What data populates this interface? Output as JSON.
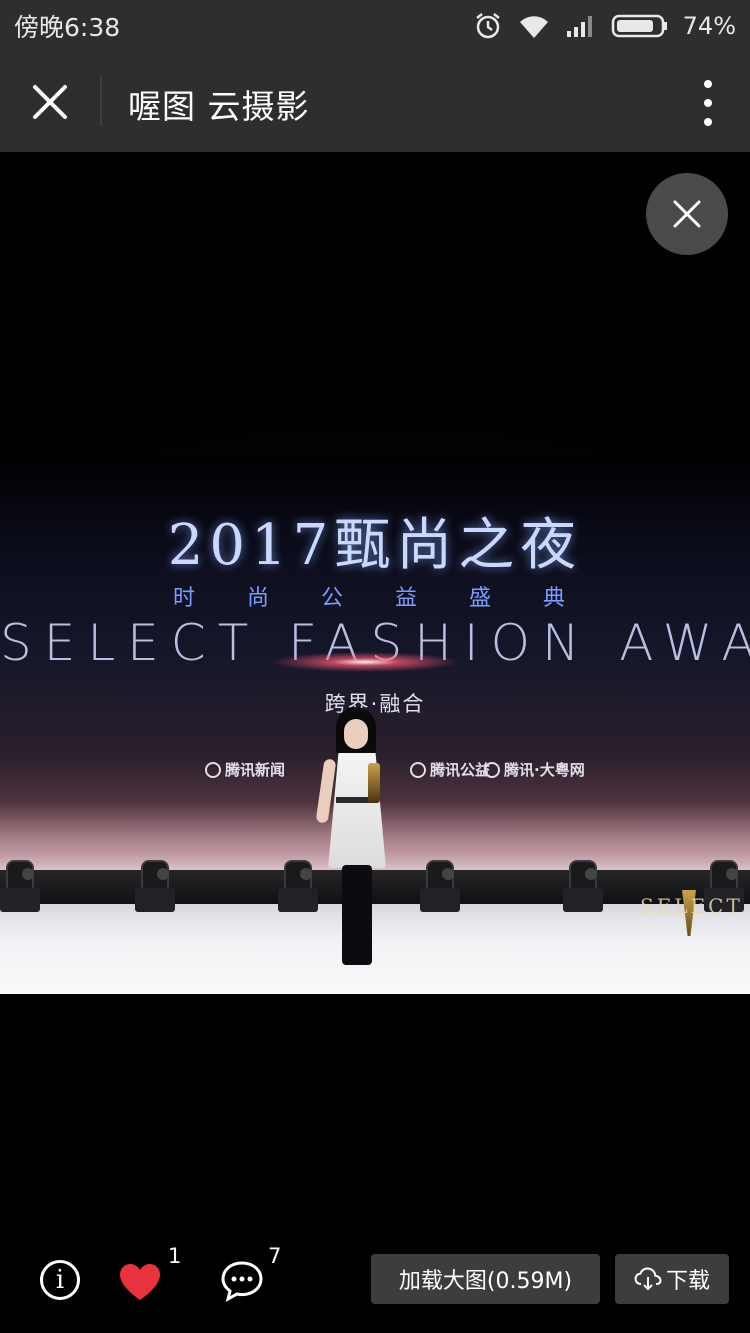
{
  "status_bar": {
    "time": "傍晚6:38",
    "battery_percent": "74%",
    "icons": [
      "alarm-icon",
      "wifi-icon",
      "signal-icon",
      "battery-icon"
    ]
  },
  "title_bar": {
    "title": "喔图 云摄影",
    "close_icon": "close-icon",
    "more_icon": "more-vertical-icon"
  },
  "viewer": {
    "close_icon": "close-icon"
  },
  "photo": {
    "event_title": "2017甄尚之夜",
    "event_subtitle": "时尚公益盛典",
    "event_name_en": "SELECT FASHION AWARDS",
    "event_tagline": "跨界·融合",
    "sponsors": [
      "腾讯新闻",
      "腾讯公益",
      "腾讯·大粤网"
    ],
    "logo_text": "SELECT"
  },
  "bottom_bar": {
    "info_icon": "info-icon",
    "like_icon": "heart-icon",
    "like_count": "1",
    "comment_icon": "comment-icon",
    "comment_count": "7",
    "load_full_label": "加载大图(0.59M)",
    "download_label": "下载",
    "download_icon": "cloud-download-icon"
  },
  "colors": {
    "bar_background": "#2e2e30",
    "heart": "#e8333f",
    "button_background": "#3d3d3d"
  }
}
